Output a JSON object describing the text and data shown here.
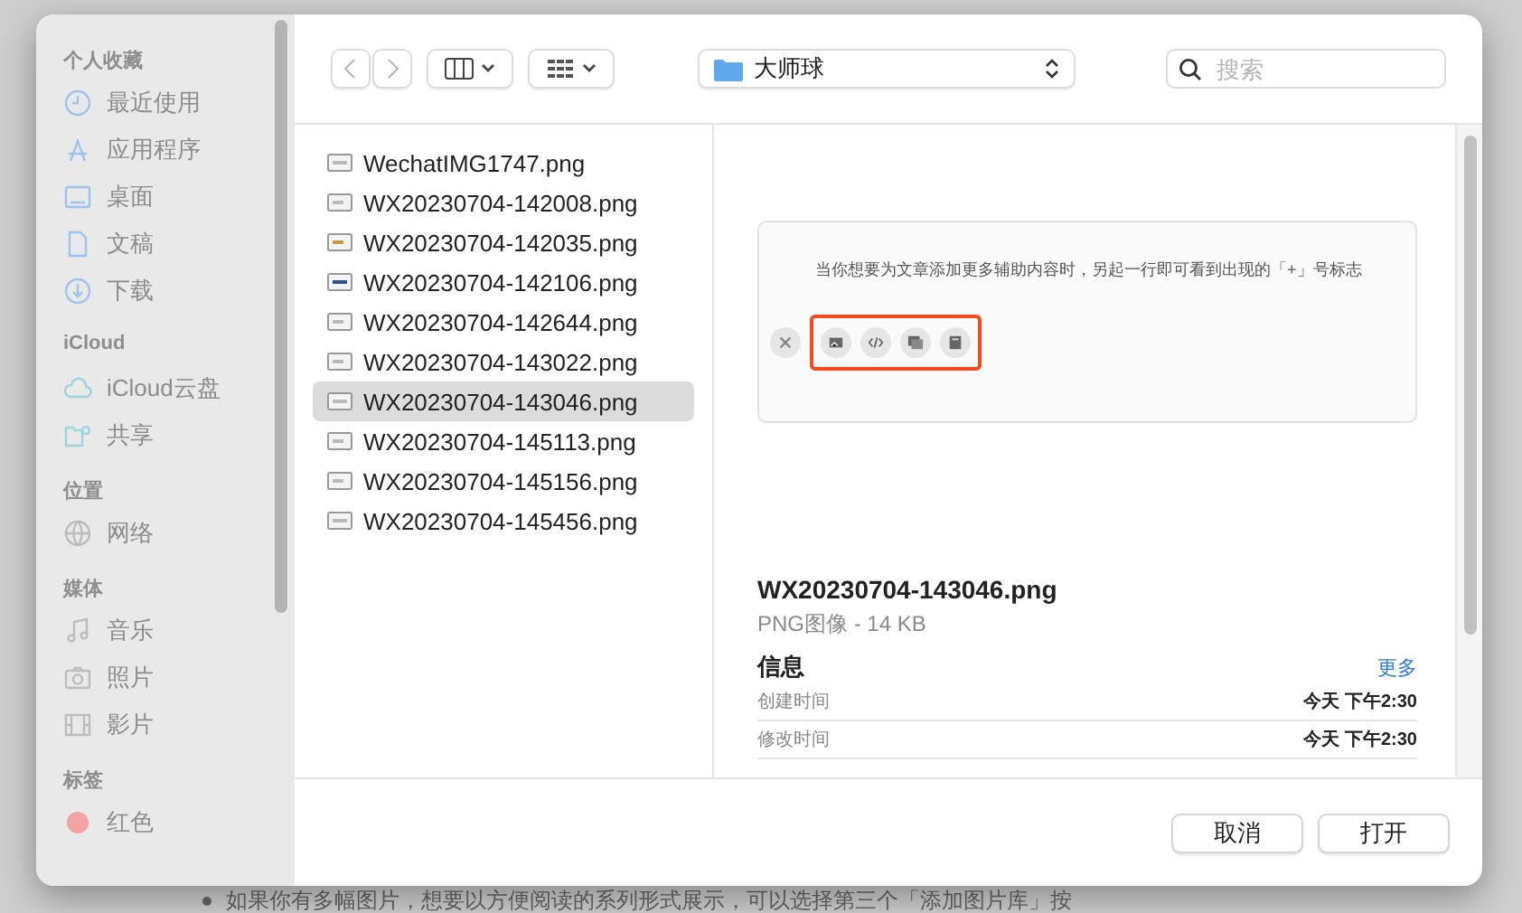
{
  "background": {
    "bullet_text": "如果你有多幅图片，想要以方便阅读的系列形式展示，可以选择第三个「添加图片库」按"
  },
  "sidebar": {
    "sections": [
      {
        "heading": "个人收藏",
        "items": [
          {
            "label": "最近使用",
            "kind": "clock"
          },
          {
            "label": "应用程序",
            "kind": "apps"
          },
          {
            "label": "桌面",
            "kind": "desktop"
          },
          {
            "label": "文稿",
            "kind": "doc"
          },
          {
            "label": "下载",
            "kind": "download"
          }
        ]
      },
      {
        "heading": "iCloud",
        "items": [
          {
            "label": "iCloud云盘",
            "kind": "cloud"
          },
          {
            "label": "共享",
            "kind": "shared"
          }
        ]
      },
      {
        "heading": "位置",
        "items": [
          {
            "label": "网络",
            "kind": "network"
          }
        ]
      },
      {
        "heading": "媒体",
        "items": [
          {
            "label": "音乐",
            "kind": "music"
          },
          {
            "label": "照片",
            "kind": "photo"
          },
          {
            "label": "影片",
            "kind": "film"
          }
        ]
      },
      {
        "heading": "标签",
        "items": [
          {
            "label": "红色",
            "kind": "tag",
            "color": "#f2a3a3"
          }
        ]
      }
    ]
  },
  "toolbar": {
    "location": "大师球",
    "search": {
      "placeholder": "搜索"
    }
  },
  "files": [
    {
      "name": "WechatIMG1747.png",
      "selected": false
    },
    {
      "name": "WX20230704-142008.png",
      "selected": false
    },
    {
      "name": "WX20230704-142035.png",
      "selected": false
    },
    {
      "name": "WX20230704-142106.png",
      "selected": false
    },
    {
      "name": "WX20230704-142644.png",
      "selected": false
    },
    {
      "name": "WX20230704-143022.png",
      "selected": false
    },
    {
      "name": "WX20230704-143046.png",
      "selected": true
    },
    {
      "name": "WX20230704-145113.png",
      "selected": false
    },
    {
      "name": "WX20230704-145156.png",
      "selected": false
    },
    {
      "name": "WX20230704-145456.png",
      "selected": false
    }
  ],
  "preview": {
    "caption": "当你想要为文章添加更多辅助内容时，另起一行即可看到出现的「+」号标志",
    "tools": [
      {
        "kind": "close"
      },
      {
        "kind": "image"
      },
      {
        "kind": "code"
      },
      {
        "kind": "gallery"
      },
      {
        "kind": "box"
      }
    ],
    "file_name": "WX20230704-143046.png",
    "file_type": "PNG图像 - 14 KB",
    "info_heading": "信息",
    "more_link": "更多",
    "info_rows": [
      {
        "label": "创建时间",
        "value": "今天 下午2:30"
      },
      {
        "label": "修改时间",
        "value": "今天 下午2:30"
      }
    ]
  },
  "buttons": [
    {
      "label": "取消"
    },
    {
      "label": "打开"
    }
  ]
}
